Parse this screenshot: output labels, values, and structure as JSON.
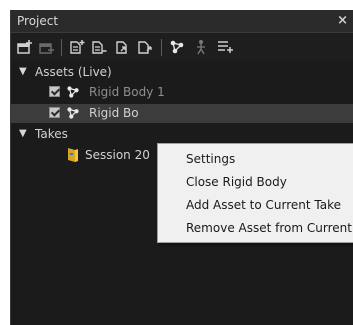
{
  "panel": {
    "title": "Project",
    "close_glyph": "×"
  },
  "toolbar": {
    "icons": [
      "add-asset-icon",
      "remove-asset-icon",
      "new-take-icon",
      "delete-take-icon",
      "import-take-icon",
      "export-take-icon",
      "skeleton-icon",
      "rigid-body-tool-icon",
      "list-add-icon"
    ]
  },
  "tree": {
    "assets_group": "Assets (Live)",
    "assets": [
      {
        "label": "Rigid Body 1",
        "checked": true
      },
      {
        "label": "Rigid Bo",
        "checked": true
      }
    ],
    "takes_group": "Takes",
    "takes": [
      {
        "label": "Session 20"
      }
    ]
  },
  "context_menu": {
    "items": [
      "Settings",
      "Close Rigid Body",
      "Add Asset to Current Take",
      "Remove Asset from Current Take"
    ]
  },
  "colors": {
    "panel_bg": "#1b1b1b",
    "titlebar_bg": "#2b2b2b",
    "selected_row": "#3c3c3c",
    "menu_bg": "#f0f0f0",
    "accent_yellow": "#e0b020"
  }
}
